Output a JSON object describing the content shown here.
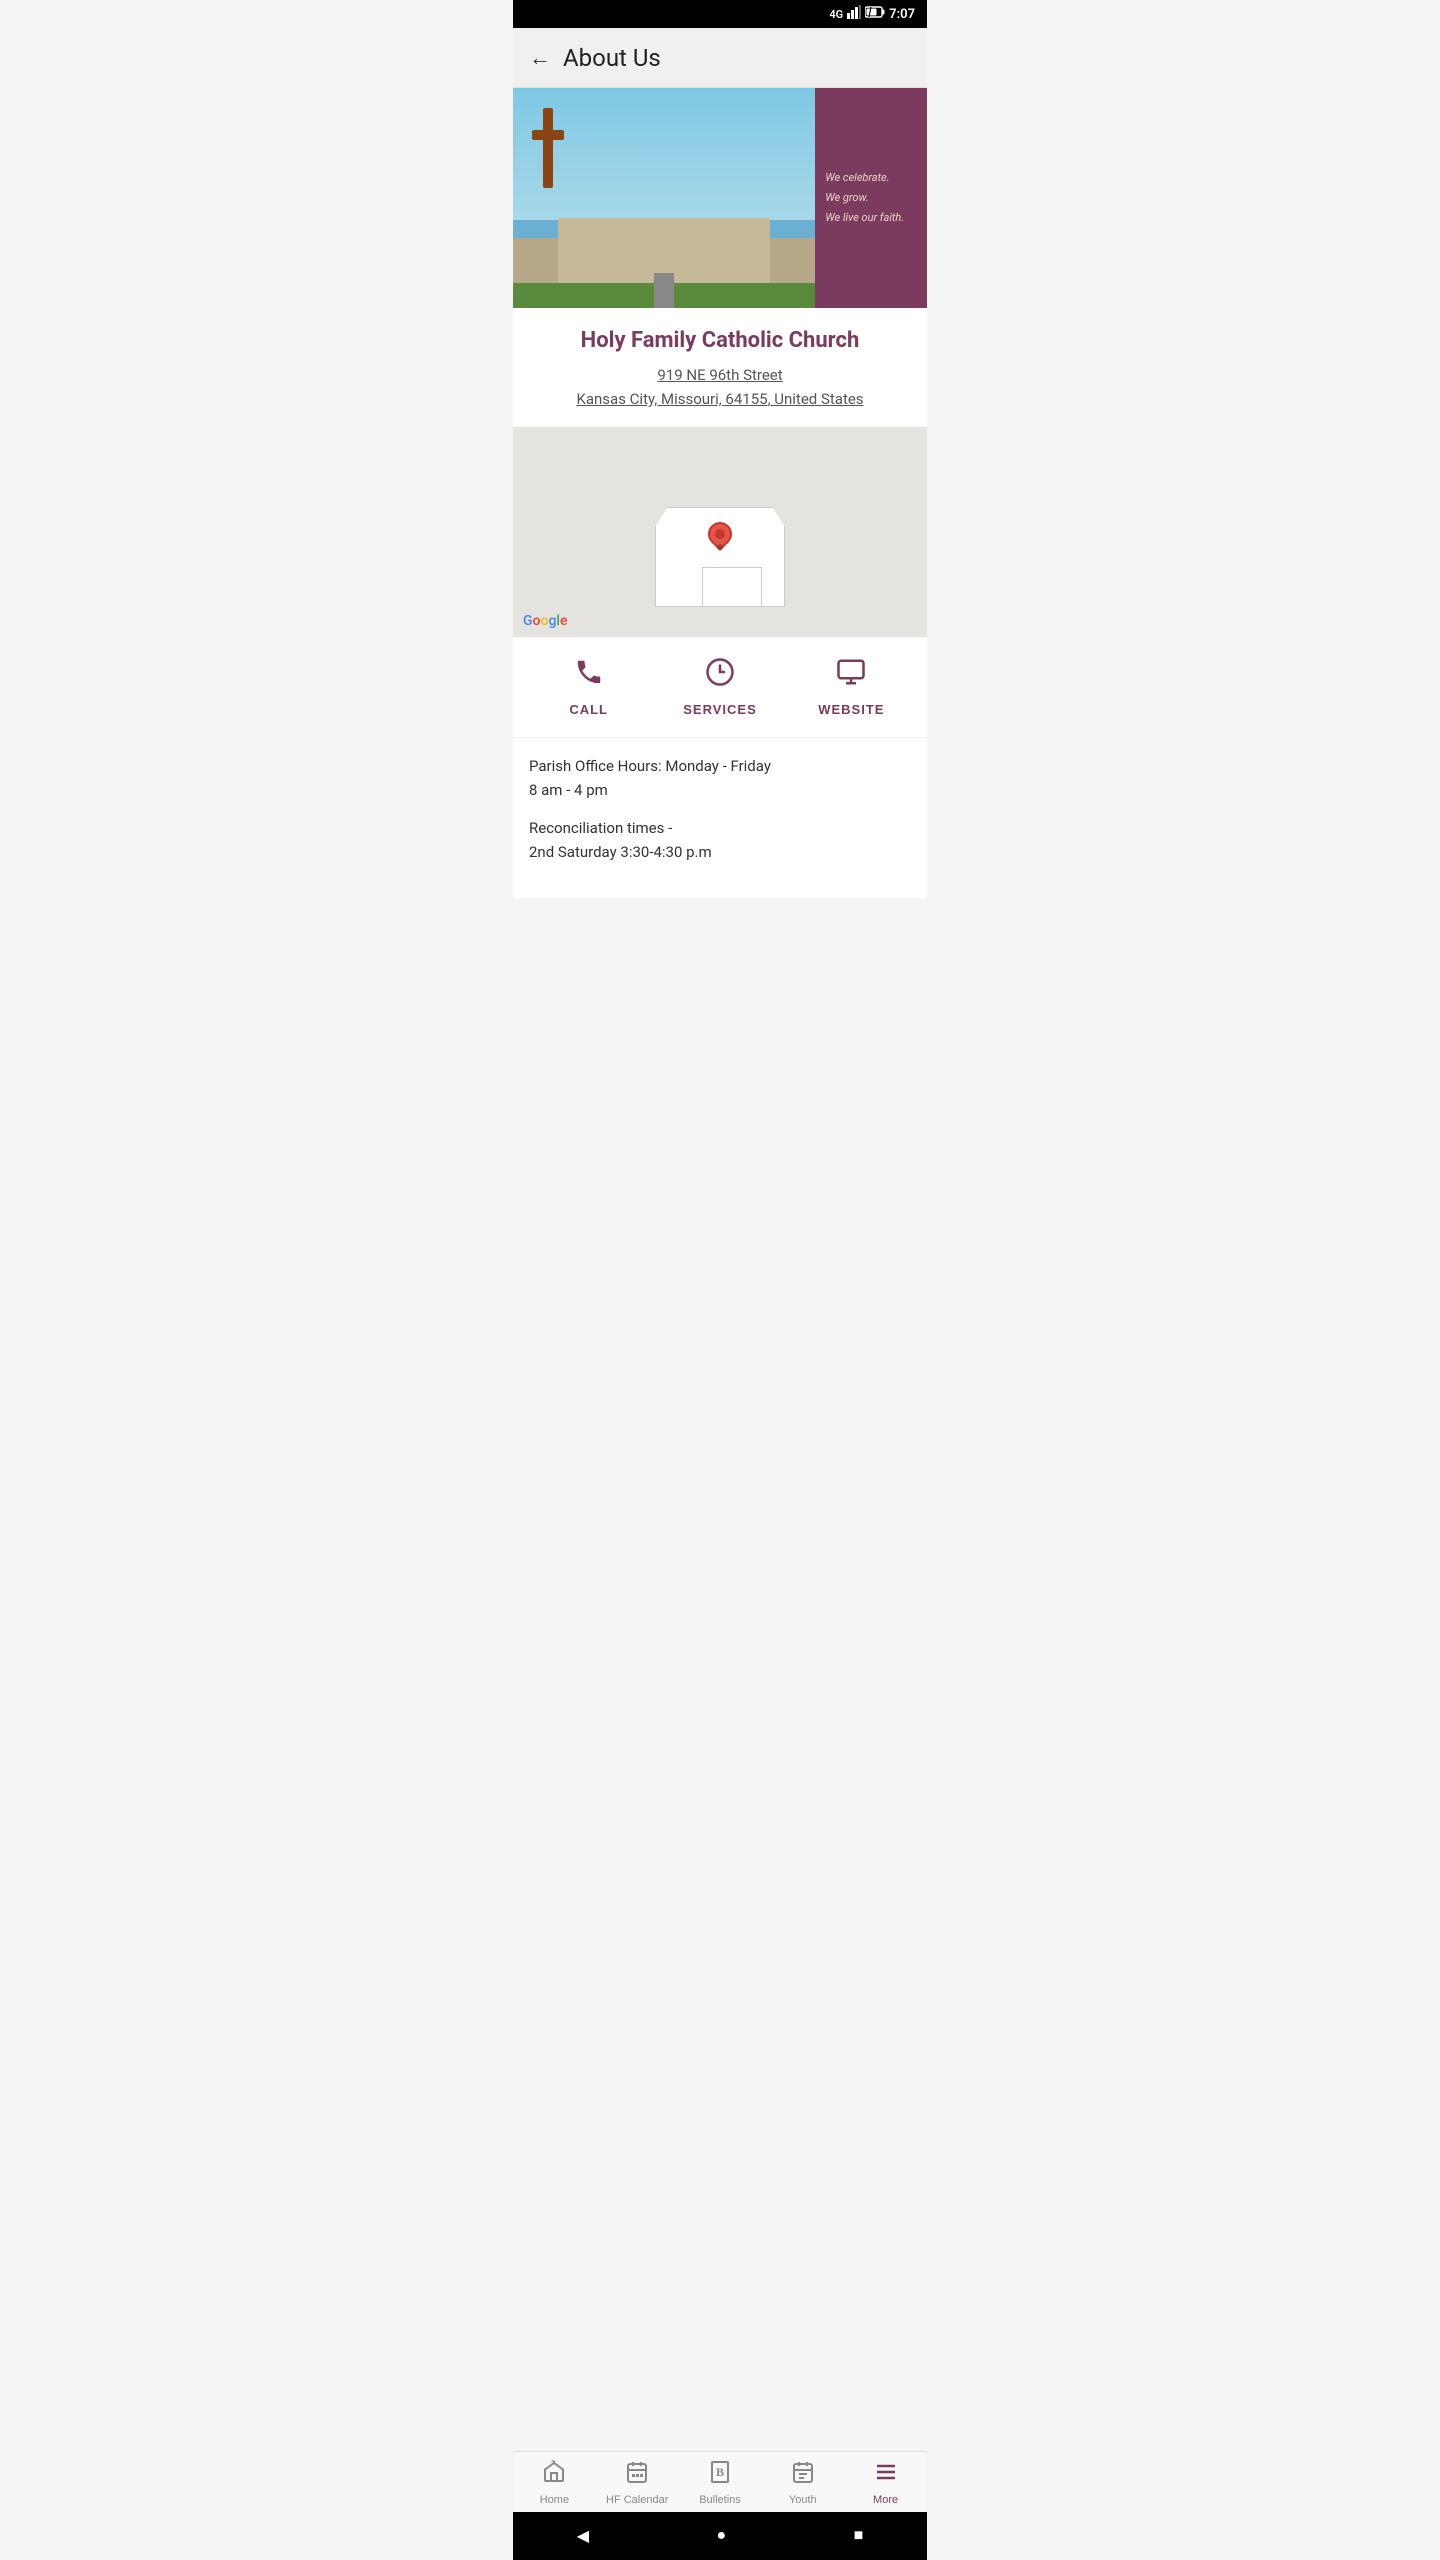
{
  "status_bar": {
    "signal": "4G",
    "time": "7:07"
  },
  "header": {
    "back_label": "←",
    "title": "About Us"
  },
  "hero": {
    "motto_lines": [
      "We celebrate.",
      "We grow.",
      "We live our faith."
    ]
  },
  "church": {
    "name": "Holy Family Catholic Church",
    "address_line1": "919 NE 96th Street",
    "address_line2": "Kansas City, Missouri, 64155",
    "address_suffix": ", United States"
  },
  "actions": [
    {
      "id": "call",
      "label": "CALL"
    },
    {
      "id": "services",
      "label": "SERVICES"
    },
    {
      "id": "website",
      "label": "WEBSITE"
    }
  ],
  "info": {
    "paragraph1": "Parish Office Hours: Monday - Friday\n8 am - 4 pm",
    "paragraph2": "Reconciliation times -\n2nd Saturday 3:30-4:30 p.m."
  },
  "bottom_nav": {
    "items": [
      {
        "id": "home",
        "label": "Home",
        "active": false
      },
      {
        "id": "hf-calendar",
        "label": "HF Calendar",
        "active": false
      },
      {
        "id": "bulletins",
        "label": "Bulletins",
        "active": false
      },
      {
        "id": "youth",
        "label": "Youth",
        "active": false
      },
      {
        "id": "more",
        "label": "More",
        "active": true
      }
    ]
  },
  "system_bar": {
    "back_label": "◀",
    "home_label": "●",
    "recent_label": "■"
  },
  "google_logo": "Google"
}
